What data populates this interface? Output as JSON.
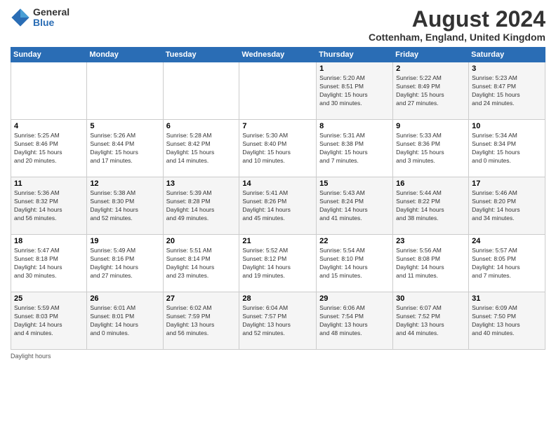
{
  "header": {
    "logo_general": "General",
    "logo_blue": "Blue",
    "month_year": "August 2024",
    "location": "Cottenham, England, United Kingdom"
  },
  "weekdays": [
    "Sunday",
    "Monday",
    "Tuesday",
    "Wednesday",
    "Thursday",
    "Friday",
    "Saturday"
  ],
  "weeks": [
    [
      {
        "day": "",
        "info": ""
      },
      {
        "day": "",
        "info": ""
      },
      {
        "day": "",
        "info": ""
      },
      {
        "day": "",
        "info": ""
      },
      {
        "day": "1",
        "info": "Sunrise: 5:20 AM\nSunset: 8:51 PM\nDaylight: 15 hours\nand 30 minutes."
      },
      {
        "day": "2",
        "info": "Sunrise: 5:22 AM\nSunset: 8:49 PM\nDaylight: 15 hours\nand 27 minutes."
      },
      {
        "day": "3",
        "info": "Sunrise: 5:23 AM\nSunset: 8:47 PM\nDaylight: 15 hours\nand 24 minutes."
      }
    ],
    [
      {
        "day": "4",
        "info": "Sunrise: 5:25 AM\nSunset: 8:46 PM\nDaylight: 15 hours\nand 20 minutes."
      },
      {
        "day": "5",
        "info": "Sunrise: 5:26 AM\nSunset: 8:44 PM\nDaylight: 15 hours\nand 17 minutes."
      },
      {
        "day": "6",
        "info": "Sunrise: 5:28 AM\nSunset: 8:42 PM\nDaylight: 15 hours\nand 14 minutes."
      },
      {
        "day": "7",
        "info": "Sunrise: 5:30 AM\nSunset: 8:40 PM\nDaylight: 15 hours\nand 10 minutes."
      },
      {
        "day": "8",
        "info": "Sunrise: 5:31 AM\nSunset: 8:38 PM\nDaylight: 15 hours\nand 7 minutes."
      },
      {
        "day": "9",
        "info": "Sunrise: 5:33 AM\nSunset: 8:36 PM\nDaylight: 15 hours\nand 3 minutes."
      },
      {
        "day": "10",
        "info": "Sunrise: 5:34 AM\nSunset: 8:34 PM\nDaylight: 15 hours\nand 0 minutes."
      }
    ],
    [
      {
        "day": "11",
        "info": "Sunrise: 5:36 AM\nSunset: 8:32 PM\nDaylight: 14 hours\nand 56 minutes."
      },
      {
        "day": "12",
        "info": "Sunrise: 5:38 AM\nSunset: 8:30 PM\nDaylight: 14 hours\nand 52 minutes."
      },
      {
        "day": "13",
        "info": "Sunrise: 5:39 AM\nSunset: 8:28 PM\nDaylight: 14 hours\nand 49 minutes."
      },
      {
        "day": "14",
        "info": "Sunrise: 5:41 AM\nSunset: 8:26 PM\nDaylight: 14 hours\nand 45 minutes."
      },
      {
        "day": "15",
        "info": "Sunrise: 5:43 AM\nSunset: 8:24 PM\nDaylight: 14 hours\nand 41 minutes."
      },
      {
        "day": "16",
        "info": "Sunrise: 5:44 AM\nSunset: 8:22 PM\nDaylight: 14 hours\nand 38 minutes."
      },
      {
        "day": "17",
        "info": "Sunrise: 5:46 AM\nSunset: 8:20 PM\nDaylight: 14 hours\nand 34 minutes."
      }
    ],
    [
      {
        "day": "18",
        "info": "Sunrise: 5:47 AM\nSunset: 8:18 PM\nDaylight: 14 hours\nand 30 minutes."
      },
      {
        "day": "19",
        "info": "Sunrise: 5:49 AM\nSunset: 8:16 PM\nDaylight: 14 hours\nand 27 minutes."
      },
      {
        "day": "20",
        "info": "Sunrise: 5:51 AM\nSunset: 8:14 PM\nDaylight: 14 hours\nand 23 minutes."
      },
      {
        "day": "21",
        "info": "Sunrise: 5:52 AM\nSunset: 8:12 PM\nDaylight: 14 hours\nand 19 minutes."
      },
      {
        "day": "22",
        "info": "Sunrise: 5:54 AM\nSunset: 8:10 PM\nDaylight: 14 hours\nand 15 minutes."
      },
      {
        "day": "23",
        "info": "Sunrise: 5:56 AM\nSunset: 8:08 PM\nDaylight: 14 hours\nand 11 minutes."
      },
      {
        "day": "24",
        "info": "Sunrise: 5:57 AM\nSunset: 8:05 PM\nDaylight: 14 hours\nand 7 minutes."
      }
    ],
    [
      {
        "day": "25",
        "info": "Sunrise: 5:59 AM\nSunset: 8:03 PM\nDaylight: 14 hours\nand 4 minutes."
      },
      {
        "day": "26",
        "info": "Sunrise: 6:01 AM\nSunset: 8:01 PM\nDaylight: 14 hours\nand 0 minutes."
      },
      {
        "day": "27",
        "info": "Sunrise: 6:02 AM\nSunset: 7:59 PM\nDaylight: 13 hours\nand 56 minutes."
      },
      {
        "day": "28",
        "info": "Sunrise: 6:04 AM\nSunset: 7:57 PM\nDaylight: 13 hours\nand 52 minutes."
      },
      {
        "day": "29",
        "info": "Sunrise: 6:06 AM\nSunset: 7:54 PM\nDaylight: 13 hours\nand 48 minutes."
      },
      {
        "day": "30",
        "info": "Sunrise: 6:07 AM\nSunset: 7:52 PM\nDaylight: 13 hours\nand 44 minutes."
      },
      {
        "day": "31",
        "info": "Sunrise: 6:09 AM\nSunset: 7:50 PM\nDaylight: 13 hours\nand 40 minutes."
      }
    ]
  ],
  "footer": {
    "daylight_label": "Daylight hours"
  }
}
